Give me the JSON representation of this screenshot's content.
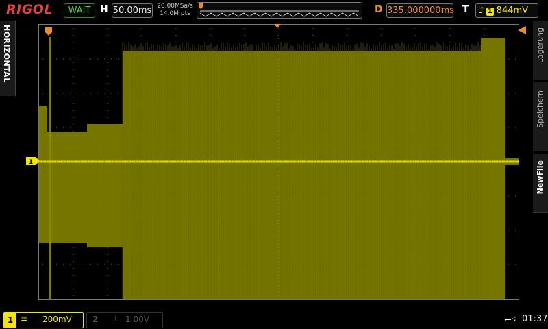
{
  "header": {
    "brand": "RIGOL",
    "run_status": "WAIT",
    "horizontal_label": "H",
    "timebase": "50.00ms",
    "sample_rate": "20.00MSa/s",
    "memory_depth": "14.0M pts",
    "delay_label": "D",
    "delay": "335.000000ms",
    "trigger_label": "T",
    "trigger_source": "1",
    "trigger_level": "844mV"
  },
  "left_tab": {
    "label": "HORIZONTAL"
  },
  "right_menu": {
    "items": [
      {
        "label": "Lagerung"
      },
      {
        "label": "Speichern"
      },
      {
        "label": "NewFile"
      }
    ]
  },
  "channels": {
    "ch1": {
      "number": "1",
      "coupling": "≡",
      "scale": "200mV",
      "color": "#f2e600"
    },
    "ch2": {
      "number": "2",
      "coupling": "⊥",
      "scale": "1.00V",
      "color": "#555555"
    }
  },
  "status": {
    "time": "01:37",
    "usb_icon": "usb-icon"
  },
  "waveform": {
    "color": "#8a8a00",
    "marker": "1"
  }
}
